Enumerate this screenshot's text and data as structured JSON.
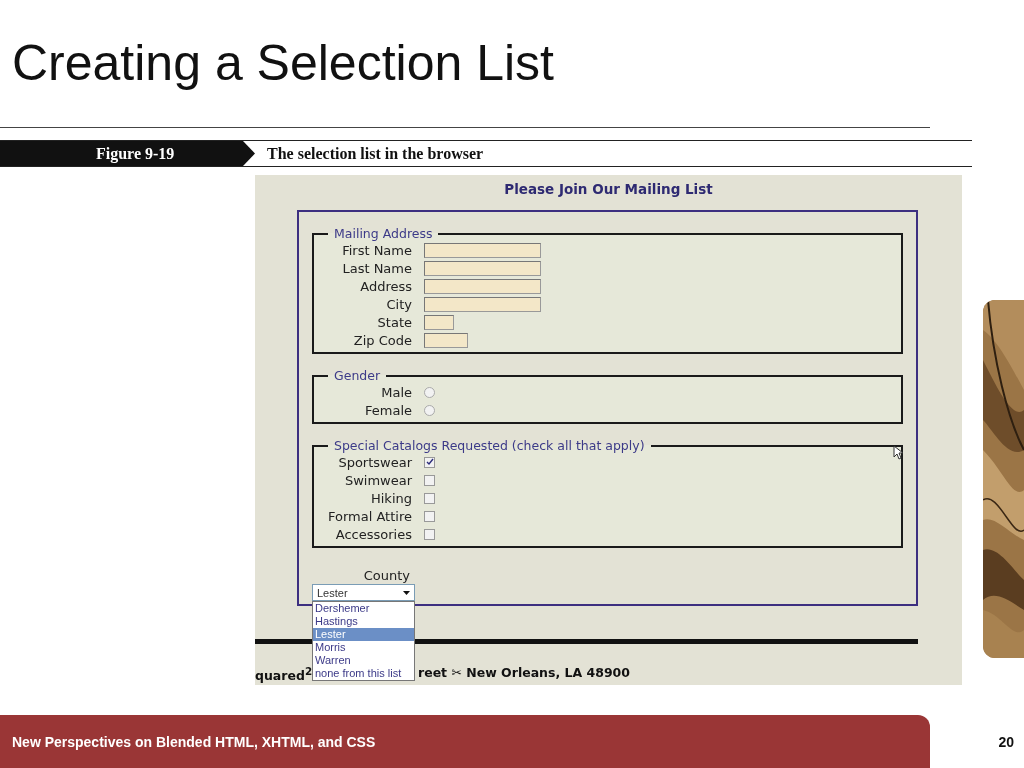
{
  "slide": {
    "title": "Creating a Selection List",
    "footer": "New Perspectives on Blended HTML, XHTML, and CSS",
    "page_number": "20"
  },
  "figure": {
    "label": "Figure 9-19",
    "caption": "The selection list in the browser"
  },
  "browser": {
    "heading": "Please Join Our Mailing List",
    "fieldsets": [
      {
        "legend": "Mailing Address",
        "kind": "text",
        "fields": [
          {
            "label": "First Name"
          },
          {
            "label": "Last Name"
          },
          {
            "label": "Address"
          },
          {
            "label": "City"
          },
          {
            "label": "State"
          },
          {
            "label": "Zip Code"
          }
        ]
      },
      {
        "legend": "Gender",
        "kind": "radio",
        "fields": [
          {
            "label": "Male",
            "checked": false
          },
          {
            "label": "Female",
            "checked": false
          }
        ]
      },
      {
        "legend": "Special Catalogs Requested (check all that apply)",
        "kind": "checkbox",
        "fields": [
          {
            "label": "Sportswear",
            "checked": true
          },
          {
            "label": "Swimwear",
            "checked": false
          },
          {
            "label": "Hiking",
            "checked": false
          },
          {
            "label": "Formal Attire",
            "checked": false
          },
          {
            "label": "Accessories",
            "checked": false
          }
        ]
      }
    ],
    "county": {
      "label": "County",
      "value": "Lester",
      "expanded": true,
      "options": [
        {
          "label": "Dershemer",
          "selected": false
        },
        {
          "label": "Hastings",
          "selected": false
        },
        {
          "label": "Lester",
          "selected": true
        },
        {
          "label": "Morris",
          "selected": false
        },
        {
          "label": "Warren",
          "selected": false
        },
        {
          "label": "none from this list",
          "selected": false
        }
      ]
    },
    "address_line": {
      "left": "quared$^{2}$",
      "right": "reet ✂ New Orleans, LA 48900"
    }
  }
}
